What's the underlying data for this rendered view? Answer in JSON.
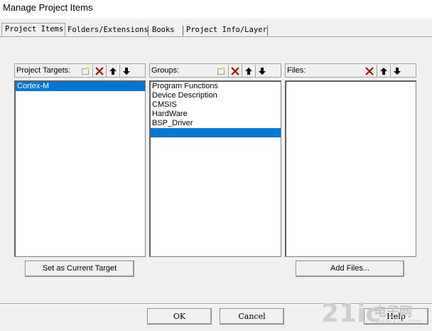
{
  "window": {
    "title": "Manage Project Items"
  },
  "tabs": [
    {
      "label": "Project Items"
    },
    {
      "label": "Folders/Extensions"
    },
    {
      "label": "Books"
    },
    {
      "label": "Project Info/Layer"
    }
  ],
  "targets": {
    "label": "Project Targets:",
    "items": [
      "Cortex-M"
    ]
  },
  "groups": {
    "label": "Groups:",
    "items": [
      "Program Functions",
      "Device Description",
      "CMSIS",
      "HardWare",
      "BSP_Driver",
      ""
    ]
  },
  "files": {
    "label": "Files:",
    "items": []
  },
  "buttons": {
    "set_current": "Set as Current Target",
    "add_files": "Add Files...",
    "ok": "OK",
    "cancel": "Cancel",
    "help": "Help"
  },
  "watermark": {
    "main": "21ic",
    "cn": "电子网",
    "url": "www.21ic.com"
  },
  "colors": {
    "selection": "#0078d7",
    "delete_red": "#c00000",
    "new_yellow": "#f5e07a"
  },
  "icons": [
    "new-item-icon",
    "delete-icon",
    "move-up-icon",
    "move-down-icon"
  ]
}
